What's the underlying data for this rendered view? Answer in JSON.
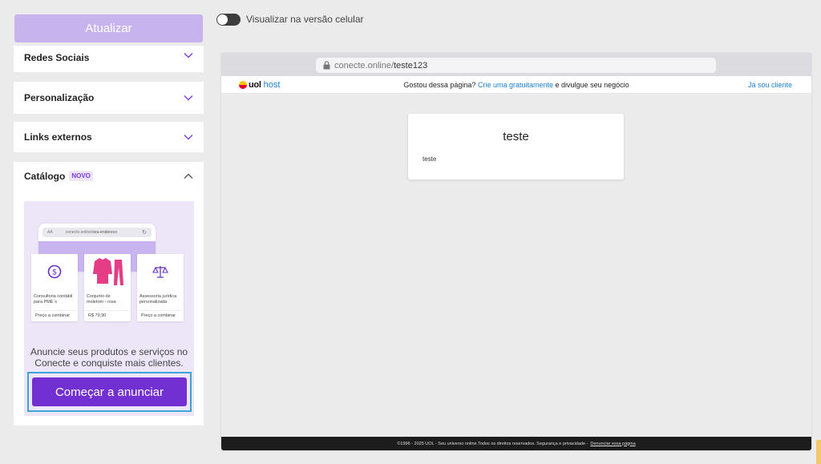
{
  "left_panel": {
    "update_label": "Atualizar",
    "sections": [
      {
        "title": "Redes Sociais"
      },
      {
        "title": "Personalização"
      },
      {
        "title": "Links externos"
      },
      {
        "title": "Catálogo",
        "badge": "NOVO"
      }
    ],
    "catalog": {
      "mock_url_host": "conecte.online/",
      "mock_url_path": "seu-endereco",
      "mock_font_label": "AA",
      "products": [
        {
          "name": "Consultoria contábil para PME´s",
          "price": "Preço a combinar",
          "icon": "dollar-coin-icon"
        },
        {
          "name": "Conjunto de moletom - rosa",
          "price": "R$ 79,90",
          "icon": "pink-sweatsuit-image"
        },
        {
          "name": "Assessoria jurídica personalizada",
          "price": "Preço a combinar",
          "icon": "scales-icon"
        }
      ],
      "promo_text": "Anuncie seus produtos e serviços no Conecte e conquiste mais clientes.",
      "cta_label": "Começar a anunciar"
    }
  },
  "toggle": {
    "label": "Visualizar na versão celular",
    "on": false
  },
  "preview": {
    "url_host": "conecte.online/",
    "url_path": "teste123",
    "brand": {
      "uol": "uol",
      "host": "host"
    },
    "promo_before": "Gostou dessa página?",
    "promo_link": "Crie uma gratuitamente",
    "promo_after": "e divulgue seu negócio",
    "client_link": "Já sou cliente",
    "card_title": "teste",
    "card_description": "teste",
    "footer_text": "©1996 - 2025 UOL - Seu universo online.Todos os direitos reservados. Segurança e privacidade -",
    "footer_link": "Denunciar essa página"
  },
  "colors": {
    "accent": "#7230d2",
    "accent_light": "#c7b3ee",
    "link": "#1b7fcf",
    "focus": "#3ba5d8"
  }
}
